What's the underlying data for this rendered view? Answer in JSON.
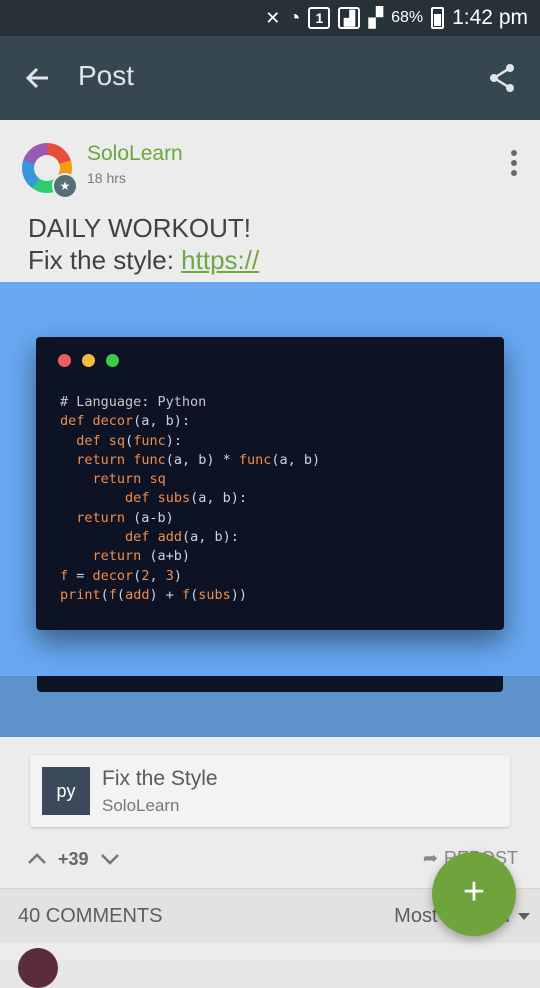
{
  "status_bar": {
    "sim_badge": "1",
    "battery_percent": "68%",
    "time": "1:42 pm"
  },
  "app_bar": {
    "title": "Post",
    "back_icon": "arrow-left-icon",
    "share_icon": "share-icon"
  },
  "post": {
    "author": "SoloLearn",
    "time": "18 hrs",
    "text_line1": "DAILY WORKOUT!",
    "text_line2_prefix": "Fix the style: ",
    "link_text": "https://",
    "more_icon": "more-vertical-icon"
  },
  "code_card": {
    "window_dots": [
      "#ed5e5e",
      "#f6bc3c",
      "#3fcb4a"
    ],
    "lines": [
      "# Language: Python",
      "def decor(a, b):",
      "  def sq(func):",
      "  return func(a, b) * func(a, b)",
      "    return sq",
      "        def subs(a, b):",
      "  return (a-b)",
      "        def add(a, b):",
      "    return (a+b)",
      "f = decor(2, 3)",
      "print(f(add) + f(subs))"
    ]
  },
  "lesson": {
    "badge": "py",
    "title": "Fix the Style",
    "subtitle": "SoloLearn"
  },
  "votes": {
    "count": "+39",
    "repost": "REPOST"
  },
  "comments": {
    "count_label": "40 COMMENTS",
    "sort_label": "Most Popular"
  },
  "fab": {
    "label": "+"
  },
  "colors": {
    "app_bar": "#37474f",
    "accent_green": "#6fa43d",
    "overlay_blue": "#68a8f2",
    "code_bg": "#0d1225"
  }
}
